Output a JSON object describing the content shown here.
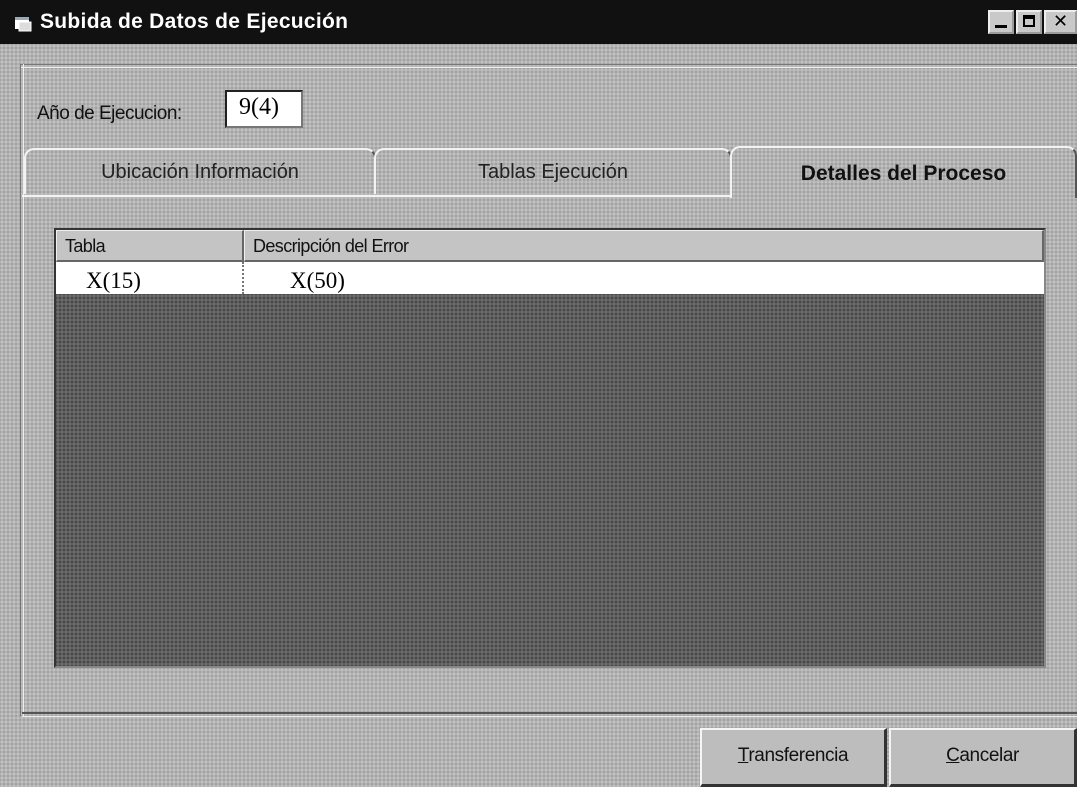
{
  "window": {
    "title": "Subida de Datos de Ejecución"
  },
  "year": {
    "label": "Año de Ejecucion:",
    "value": "9(4)"
  },
  "tabs": [
    {
      "label": "Ubicación Información",
      "active": false
    },
    {
      "label": "Tablas Ejecución",
      "active": false
    },
    {
      "label": "Detalles del Proceso",
      "active": true
    }
  ],
  "grid": {
    "columns": [
      "Tabla",
      "Descripción del Error"
    ],
    "rows": [
      [
        "X(15)",
        "X(50)"
      ]
    ]
  },
  "buttons": {
    "transfer_first": "T",
    "transfer_rest": "ransferencia",
    "cancel_first": "C",
    "cancel_rest": "ancelar"
  },
  "icons": {
    "app": "app-window-icon",
    "minimize": "minimize-icon",
    "maximize": "maximize-icon",
    "close": "close-icon"
  }
}
